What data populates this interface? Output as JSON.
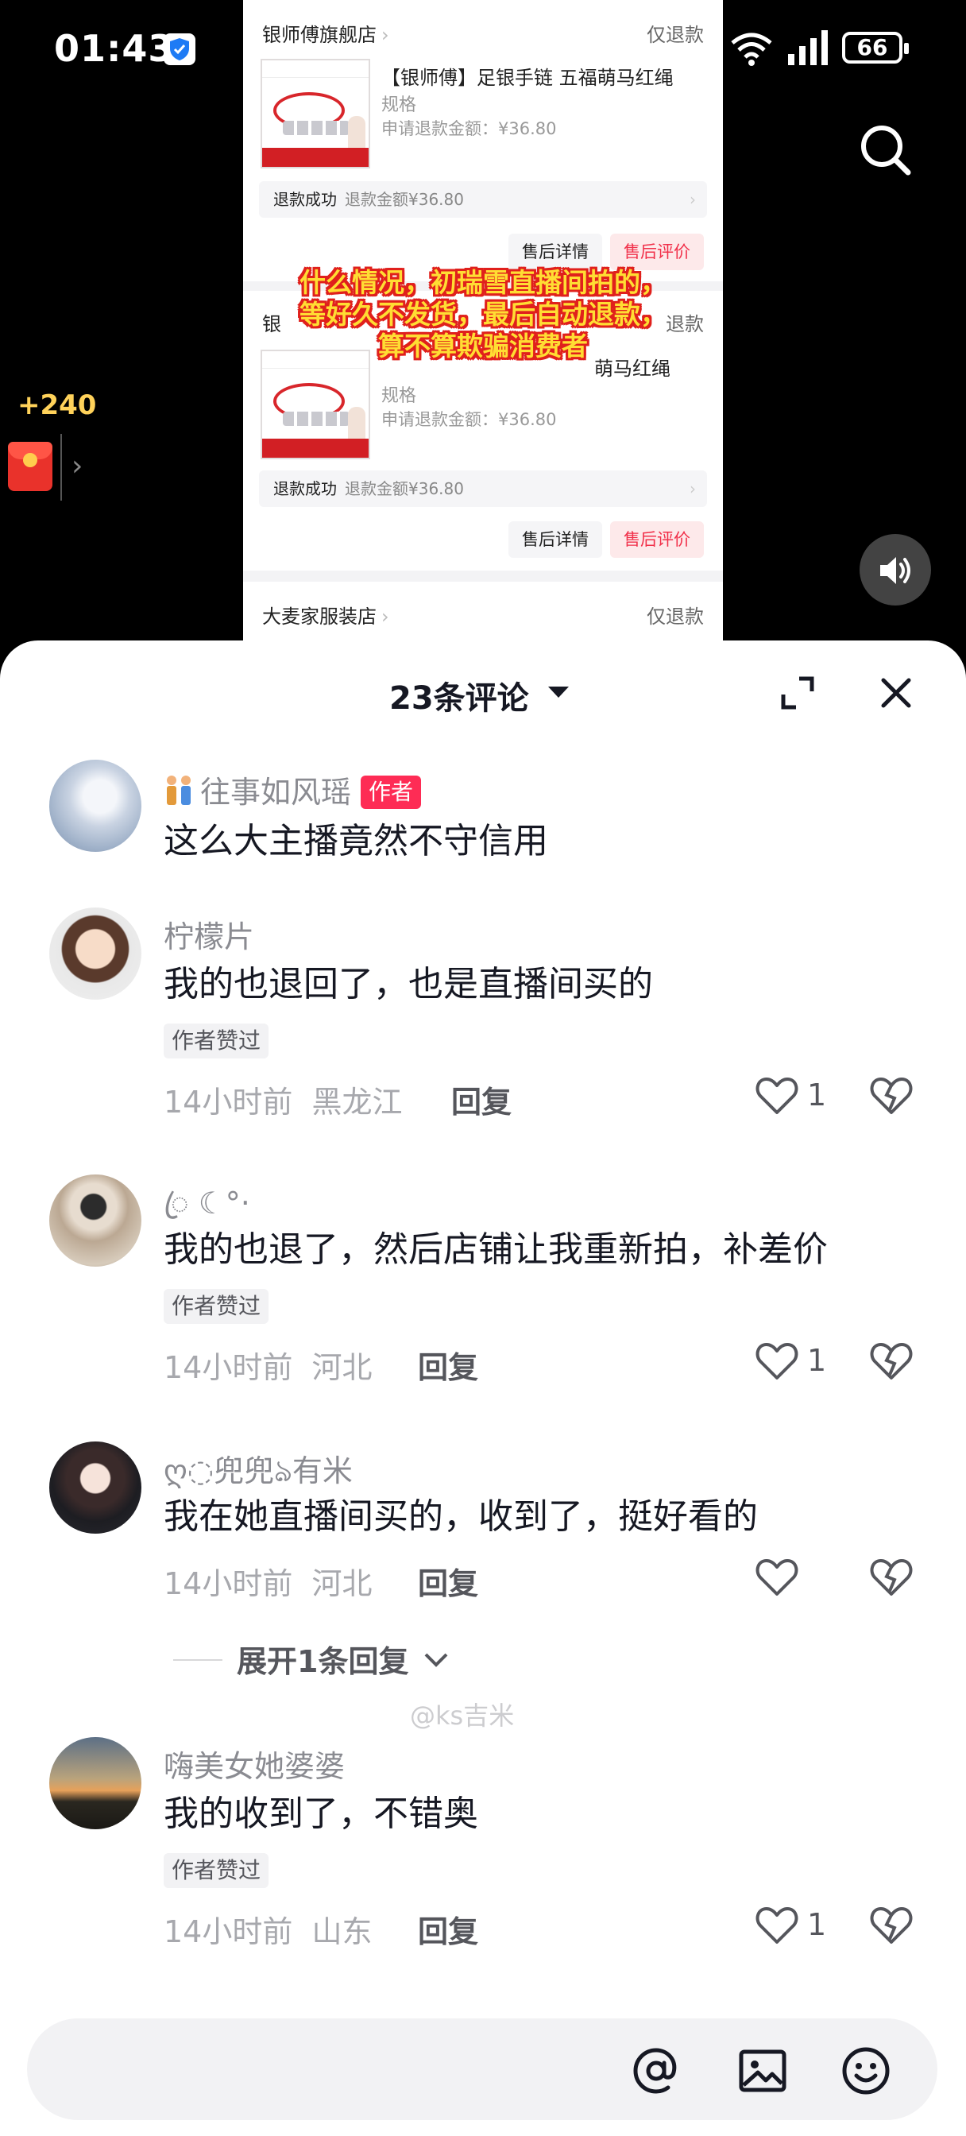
{
  "status_bar": {
    "time": "01:43",
    "battery": "66"
  },
  "rewards": {
    "coins": "+240"
  },
  "order_screenshot": {
    "cards": [
      {
        "shop": "银师傅旗舰店",
        "refund_type": "仅退款",
        "product_title": "【银师傅】足银手链 五福萌马红绳",
        "spec": "规格",
        "requested_amount": "申请退款金额：¥36.80",
        "status_label": "退款成功",
        "status_amount": "退款金额¥36.80",
        "btn_detail": "售后详情",
        "btn_review": "售后评价"
      },
      {
        "shop": "银",
        "refund_type": "退款",
        "product_title": "萌马红绳",
        "spec": "规格",
        "requested_amount": "申请退款金额：¥36.80",
        "status_label": "退款成功",
        "status_amount": "退款金额¥36.80",
        "btn_detail": "售后详情",
        "btn_review": "售后评价"
      },
      {
        "shop": "大麦家服装店",
        "refund_type": "仅退款"
      }
    ],
    "overlay_lines": [
      "什么情况，初瑞雪直播间拍的，",
      "等好久不发货，最后自动退款，",
      "算不算欺骗消费者"
    ]
  },
  "comments_panel": {
    "title": "23条评论",
    "comments": [
      {
        "user": "往事如风瑶",
        "author_tag": "作者",
        "text": "这么大主播竟然不守信用"
      },
      {
        "user": "柠檬片",
        "text": "我的也退回了，也是直播间买的",
        "liked_badge": "作者赞过",
        "time": "14小时前",
        "location": "黑龙江",
        "reply": "回复",
        "likes": "1"
      },
      {
        "user": "ꦿ ☾°·",
        "text": "我的也退了，然后店铺让我重新拍，补差价",
        "liked_badge": "作者赞过",
        "time": "14小时前",
        "location": "河北",
        "reply": "回复",
        "likes": "1"
      },
      {
        "user": "ღ◌兜兜ঌ有米",
        "text": "我在她直播间买的，收到了，挺好看的",
        "time": "14小时前",
        "location": "河北",
        "reply": "回复",
        "likes": "",
        "expand_replies": "展开1条回复"
      },
      {
        "user": "嗨美女她婆婆",
        "text": "我的收到了，不错奥",
        "liked_badge": "作者赞过",
        "time": "14小时前",
        "location": "山东",
        "reply": "回复",
        "likes": "1"
      }
    ],
    "watermark": "@ks吉米"
  },
  "input_bar": {
    "placeholder": ""
  },
  "colors": {
    "accent": "#fe2c55",
    "sheet_bg": "#ffffff",
    "meta_gray": "#a7a8ad"
  },
  "icons": [
    "search-icon",
    "volume-icon",
    "expand-icon",
    "close-icon",
    "heart-icon",
    "broken-heart-icon",
    "mention-icon",
    "image-icon",
    "emoji-icon"
  ]
}
